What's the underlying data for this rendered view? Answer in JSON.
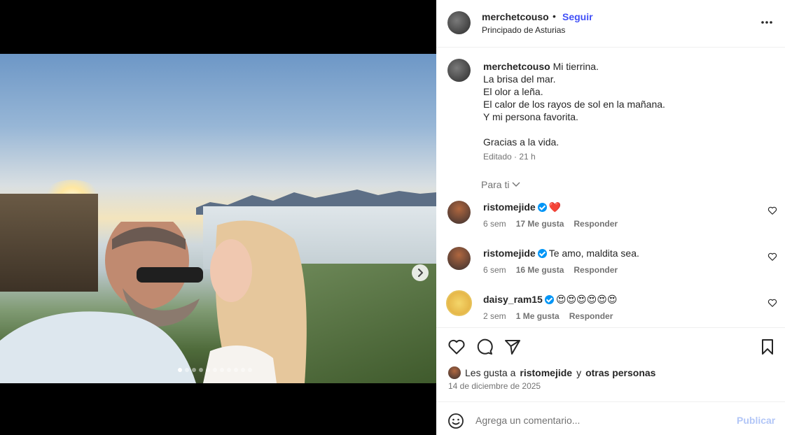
{
  "post": {
    "slides_total": 11,
    "current_slide": 1
  },
  "header": {
    "username": "merchetcouso",
    "separator": "•",
    "follow_label": "Seguir",
    "location": "Principado de Asturias"
  },
  "caption": {
    "username": "merchetcouso",
    "lines": [
      "Mi tierrina.",
      "La brisa del mar.",
      "El olor a leña.",
      "El calor de los rayos de sol en la mañana.",
      "Y mi persona favorita.",
      "",
      "Gracias a la vida."
    ],
    "meta": "Editado · 21 h"
  },
  "filter_label": "Para ti",
  "comments": [
    {
      "username": "ristomejide",
      "text": "❤️",
      "age": "6 sem",
      "likes": "17 Me gusta",
      "reply_label": "Responder"
    },
    {
      "username": "ristomejide",
      "text": "Te amo, maldita sea.",
      "age": "6 sem",
      "likes": "16 Me gusta",
      "reply_label": "Responder"
    },
    {
      "username": "daisy_ram15",
      "text": "😍😍😍😍😍😍",
      "age": "2 sem",
      "likes": "1 Me gusta",
      "reply_label": "Responder"
    }
  ],
  "likes_summary": {
    "prefix": "Les gusta a",
    "user": "ristomejide",
    "connector": "y",
    "others": "otras personas"
  },
  "date": "14 de diciembre de 2025",
  "composer": {
    "placeholder": "Agrega un comentario...",
    "publish_label": "Publicar"
  },
  "colors": {
    "follow": "#4150f7",
    "verified": "#0095f6",
    "publish_disabled": "#b2c6f7",
    "heart": "#ed4956"
  }
}
